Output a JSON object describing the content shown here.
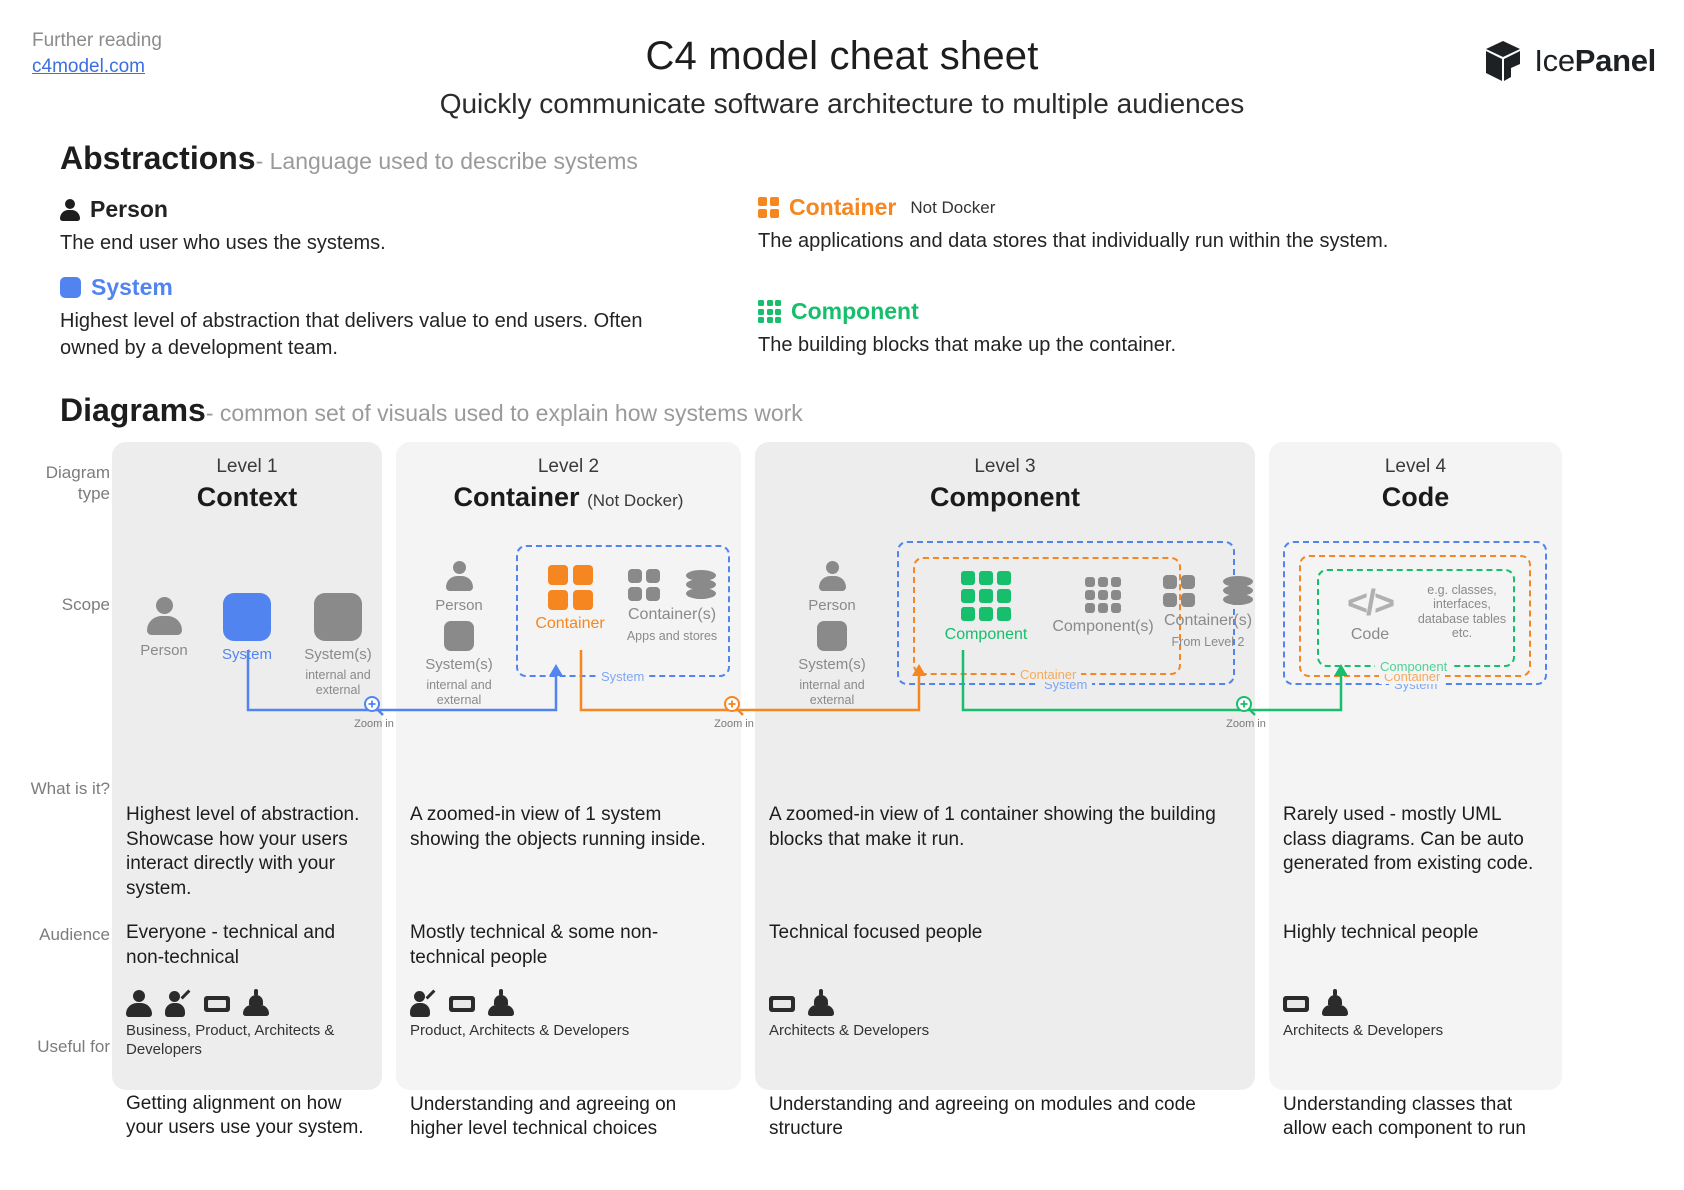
{
  "header": {
    "further_label": "Further reading",
    "further_link": "c4model.com",
    "title": "C4 model cheat sheet",
    "subtitle": "Quickly communicate software architecture to multiple audiences",
    "brand_light": "Ice",
    "brand_bold": "Panel",
    "brand_icon": "cube-logo-icon"
  },
  "abstractions": {
    "heading": "Abstractions",
    "heading_sub": "- Language used to describe systems",
    "items": [
      {
        "name": "Person",
        "note": "",
        "color": "#1d1d1d",
        "icon": "person-icon",
        "desc": "The end user who uses the systems."
      },
      {
        "name": "System",
        "note": "",
        "color": "#5284F0",
        "icon": "blue-square-icon",
        "desc": "Highest level of abstraction that delivers value to end users. Often owned by a development team."
      },
      {
        "name": "Container",
        "note": "Not Docker",
        "color": "#F6861F",
        "icon": "grid-2x2-icon",
        "desc": "The applications and data stores that individually run within the system."
      },
      {
        "name": "Component",
        "note": "",
        "color": "#17BE6C",
        "icon": "grid-3x3-icon",
        "desc": "The building blocks that make up the container."
      }
    ]
  },
  "diagrams": {
    "heading": "Diagrams",
    "heading_sub": "- common set of visuals used to explain how systems work",
    "row_labels": [
      "Diagram type",
      "Scope",
      "What is it?",
      "Audience",
      "Useful for"
    ],
    "zoom_label": "Zoom in",
    "columns": [
      {
        "level": "Level 1",
        "name": "Context",
        "name_note": "",
        "scope_nodes": [
          {
            "label": "Person",
            "sublabel": "",
            "icon": "person-figure-icon",
            "color": "gray"
          },
          {
            "label": "System",
            "sublabel": "",
            "icon": "square-icon",
            "color": "blue"
          },
          {
            "label": "System(s)",
            "sublabel": "internal and external",
            "icon": "square-icon",
            "color": "gray"
          }
        ],
        "boundaries": [],
        "what_is_it": "Highest level of abstraction. Showcase how your users interact directly with your system.",
        "audience": "Everyone - technical and non-technical",
        "audience_icons": [
          "business-icon",
          "product-icon",
          "architect-icon",
          "developer-icon"
        ],
        "audience_caption": "Business, Product, Architects & Developers",
        "useful_for": "Getting alignment on how your users use your system."
      },
      {
        "level": "Level 2",
        "name": "Container",
        "name_note": "(Not Docker)",
        "scope_nodes": [
          {
            "label": "Person",
            "sublabel": "",
            "icon": "person-figure-icon",
            "color": "gray"
          },
          {
            "label": "System(s)",
            "sublabel": "internal and external",
            "icon": "square-icon",
            "color": "gray"
          },
          {
            "label": "Container",
            "sublabel": "",
            "icon": "grid-2x2-icon",
            "color": "orange"
          },
          {
            "label": "Container(s)",
            "sublabel": "Apps and stores",
            "icon": "grid-2x2-plus-database-icon",
            "color": "gray"
          }
        ],
        "boundaries": [
          {
            "label": "System",
            "color": "blue"
          }
        ],
        "what_is_it": "A zoomed-in view of 1 system showing the objects running inside.",
        "audience": "Mostly technical & some non-technical people",
        "audience_icons": [
          "product-icon",
          "architect-icon",
          "developer-icon"
        ],
        "audience_caption": "Product, Architects & Developers",
        "useful_for": "Understanding and agreeing on higher level technical choices"
      },
      {
        "level": "Level 3",
        "name": "Component",
        "name_note": "",
        "scope_nodes": [
          {
            "label": "Person",
            "sublabel": "",
            "icon": "person-figure-icon",
            "color": "gray"
          },
          {
            "label": "System(s)",
            "sublabel": "internal and external",
            "icon": "square-icon",
            "color": "gray"
          },
          {
            "label": "Component",
            "sublabel": "",
            "icon": "grid-3x3-icon",
            "color": "green"
          },
          {
            "label": "Component(s)",
            "sublabel": "",
            "icon": "grid-3x3-icon",
            "color": "gray"
          },
          {
            "label": "Container(s)",
            "sublabel": "From Level 2",
            "icon": "grid-2x2-plus-database-icon",
            "color": "gray"
          }
        ],
        "boundaries": [
          {
            "label": "System",
            "color": "blue"
          },
          {
            "label": "Container",
            "color": "orange"
          }
        ],
        "what_is_it": "A zoomed-in view of 1 container showing the building blocks that make it run.",
        "audience": "Technical focused people",
        "audience_icons": [
          "architect-icon",
          "developer-icon"
        ],
        "audience_caption": "Architects & Developers",
        "useful_for": "Understanding and agreeing on modules and code structure"
      },
      {
        "level": "Level 4",
        "name": "Code",
        "name_note": "",
        "scope_nodes": [
          {
            "label": "Code",
            "sublabel": "",
            "icon": "code-brackets-icon",
            "color": "gray"
          },
          {
            "label": "",
            "sublabel": "e.g. classes, interfaces, database tables etc.",
            "icon": "",
            "color": "gray"
          }
        ],
        "boundaries": [
          {
            "label": "System",
            "color": "blue"
          },
          {
            "label": "Container",
            "color": "orange"
          },
          {
            "label": "Component",
            "color": "green"
          }
        ],
        "what_is_it": "Rarely used - mostly UML class diagrams. Can be auto generated from existing code.",
        "audience": "Highly technical people",
        "audience_icons": [
          "architect-icon",
          "developer-icon"
        ],
        "audience_caption": "Architects & Developers",
        "useful_for": "Understanding classes that allow each component to run"
      }
    ]
  },
  "colors": {
    "person": "#1d1d1d",
    "system": "#5284F0",
    "container": "#F6861F",
    "component": "#17BE6C",
    "gray": "#8a8a8a",
    "link": "#3b6fe0"
  }
}
